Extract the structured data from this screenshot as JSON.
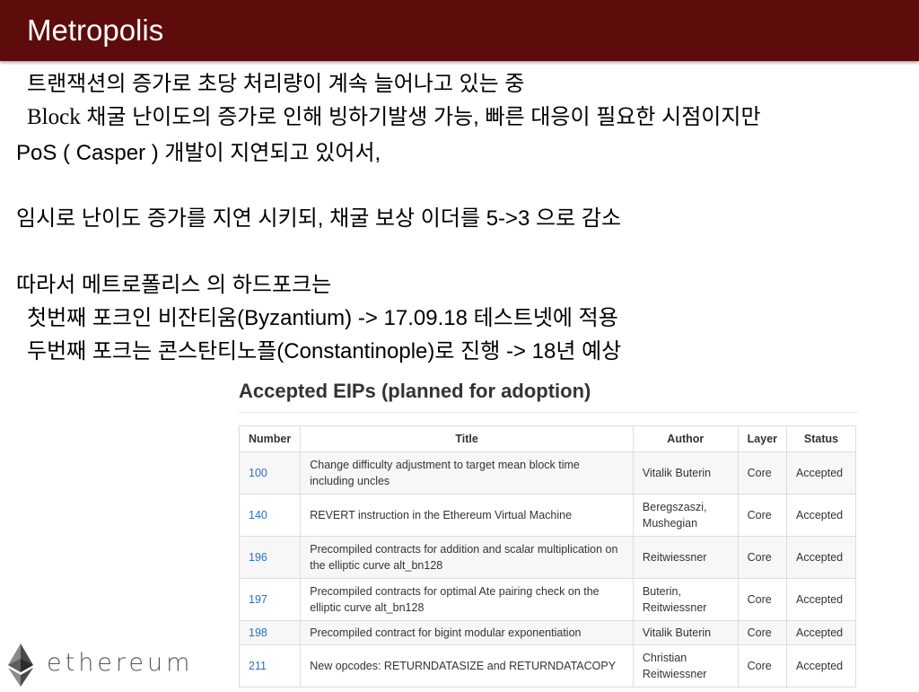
{
  "slide": {
    "title": "Metropolis",
    "lines": [
      "트랜잭션의 증가로 초당 처리량이 계속 늘어나고 있는 중",
      "채굴 난이도의 증가로 인해 빙하기발생 가능, 빠른 대응이 필요한 시점이지만",
      "PoS ( Casper ) 개발이 지연되고 있어서,",
      "임시로 난이도 증가를 지연 시키되, 채굴 보상 이더를 5->3 으로 감소",
      "따라서 메트로폴리스 의 하드포크는",
      "첫번째 포크인 비잔티움(Byzantium) ->  17.09.18 테스트넷에 적용",
      "두번째 포크는 콘스탄티노플(Constantinople)로 진행  -> 18년 예상"
    ],
    "line2_prefix": "Block"
  },
  "eips": {
    "heading": "Accepted EIPs (planned for adoption)",
    "columns": [
      "Number",
      "Title",
      "Author",
      "Layer",
      "Status"
    ],
    "rows": [
      {
        "number": "100",
        "title": "Change difficulty adjustment to target mean block time including uncles",
        "author": "Vitalik Buterin",
        "layer": "Core",
        "status": "Accepted"
      },
      {
        "number": "140",
        "title": "REVERT instruction in the Ethereum Virtual Machine",
        "author": "Beregszaszi, Mushegian",
        "layer": "Core",
        "status": "Accepted"
      },
      {
        "number": "196",
        "title": "Precompiled contracts for addition and scalar multiplication on the elliptic curve alt_bn128",
        "author": "Reitwiessner",
        "layer": "Core",
        "status": "Accepted"
      },
      {
        "number": "197",
        "title": "Precompiled contracts for optimal Ate pairing check on the elliptic curve alt_bn128",
        "author": "Buterin, Reitwiessner",
        "layer": "Core",
        "status": "Accepted"
      },
      {
        "number": "198",
        "title": "Precompiled contract for bigint modular exponentiation",
        "author": "Vitalik Buterin",
        "layer": "Core",
        "status": "Accepted"
      },
      {
        "number": "211",
        "title": "New opcodes: RETURNDATASIZE and RETURNDATACOPY",
        "author": "Christian Reitwiessner",
        "layer": "Core",
        "status": "Accepted"
      }
    ]
  },
  "logo": {
    "icon": "ethereum-diamond-icon",
    "text": "ethereum"
  },
  "colors": {
    "title_bar": "#5e0b0b",
    "link": "#2a6fc9"
  }
}
